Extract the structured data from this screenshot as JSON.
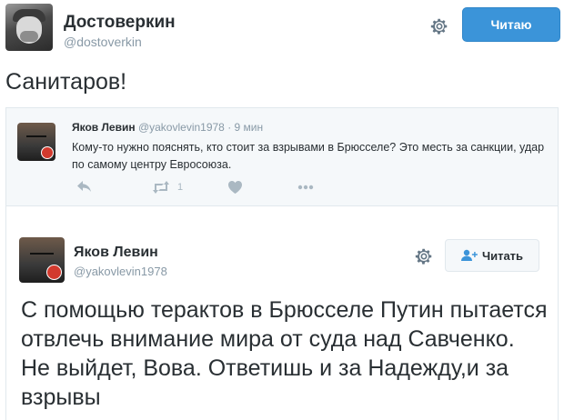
{
  "outer_tweet": {
    "author_name": "Достоверкин",
    "author_handle": "@dostoverkin",
    "follow_label": "Читаю",
    "text": "Санитаров!"
  },
  "quoted_tweet": {
    "author_name": "Яков Левин",
    "author_handle": "@yakovlevin1978",
    "time": "· 9 мин",
    "text": "Кому-то нужно пояснять, кто стоит за взрывами в Брюсселе? Это месть за санкции, удар по самому центру Евросоюза.",
    "retweet_count": "1",
    "icons": [
      "reply-icon",
      "retweet-icon",
      "like-icon",
      "more-icon"
    ]
  },
  "embedded_tweet": {
    "author_name": "Яков Левин",
    "author_handle": "@yakovlevin1978",
    "follow_label": "Читать",
    "text": "С помощью терактов в Брюсселе Путин пытается отвлечь внимание мира от суда над Савченко. Не выйдет, Вова. Ответишь и за Надежду,и за взрывы"
  },
  "colors": {
    "follow_blue": "#3b94d9",
    "handle_gray": "#8899a6",
    "action_gray": "#aab8c2",
    "text_dark": "#292f33"
  }
}
